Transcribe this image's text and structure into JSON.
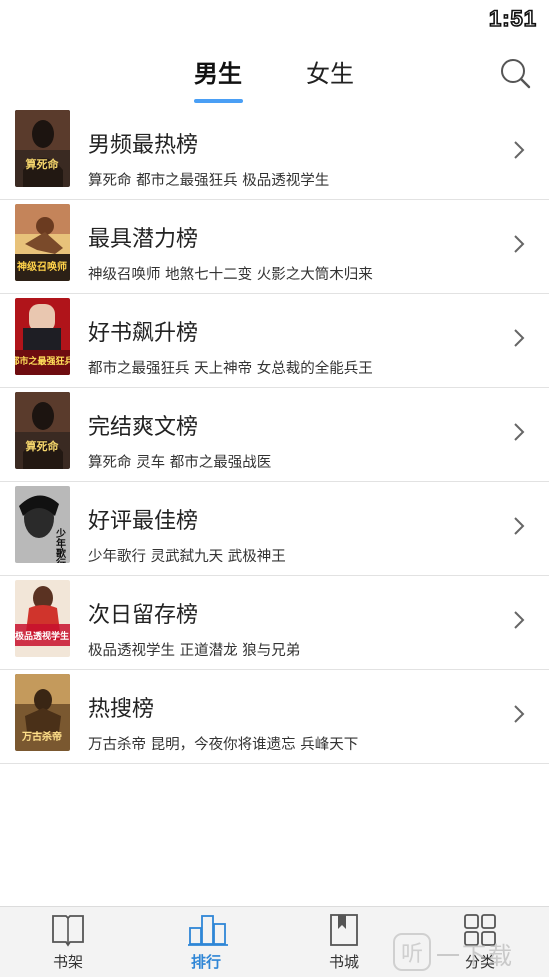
{
  "status_bar": {
    "time": "1:51"
  },
  "header": {
    "tabs": [
      {
        "label": "男生",
        "active": true
      },
      {
        "label": "女生",
        "active": false
      }
    ],
    "accent_color": "#4a9ff5",
    "search_icon": "search-icon"
  },
  "rankings": [
    {
      "title": "男频最热榜",
      "books": "算死命  都市之最强狂兵  极品透视学生",
      "cover_text": "算死命"
    },
    {
      "title": "最具潜力榜",
      "books": "神级召唤师  地煞七十二变  火影之大筒木归来",
      "cover_text": "神级召唤师"
    },
    {
      "title": "好书飙升榜",
      "books": "都市之最强狂兵  天上神帝  女总裁的全能兵王",
      "cover_text": "都市之最强狂兵"
    },
    {
      "title": "完结爽文榜",
      "books": "算死命  灵车  都市之最强战医",
      "cover_text": "算死命"
    },
    {
      "title": "好评最佳榜",
      "books": "少年歌行  灵武弑九天  武极神王",
      "cover_text": "少年歌行"
    },
    {
      "title": "次日留存榜",
      "books": "极品透视学生  正道潜龙  狼与兄弟",
      "cover_text": "极品透视学生"
    },
    {
      "title": "热搜榜",
      "books": "万古杀帝  昆明，今夜你将谁遗忘  兵峰天下",
      "cover_text": "万古杀帝"
    }
  ],
  "bottom_nav": [
    {
      "label": "书架",
      "icon": "book-icon",
      "active": false
    },
    {
      "label": "排行",
      "icon": "ranking-icon",
      "active": true
    },
    {
      "label": "书城",
      "icon": "bookmark-icon",
      "active": false
    },
    {
      "label": "分类",
      "icon": "grid-icon",
      "active": false
    }
  ],
  "watermark": {
    "text": "一下载"
  }
}
